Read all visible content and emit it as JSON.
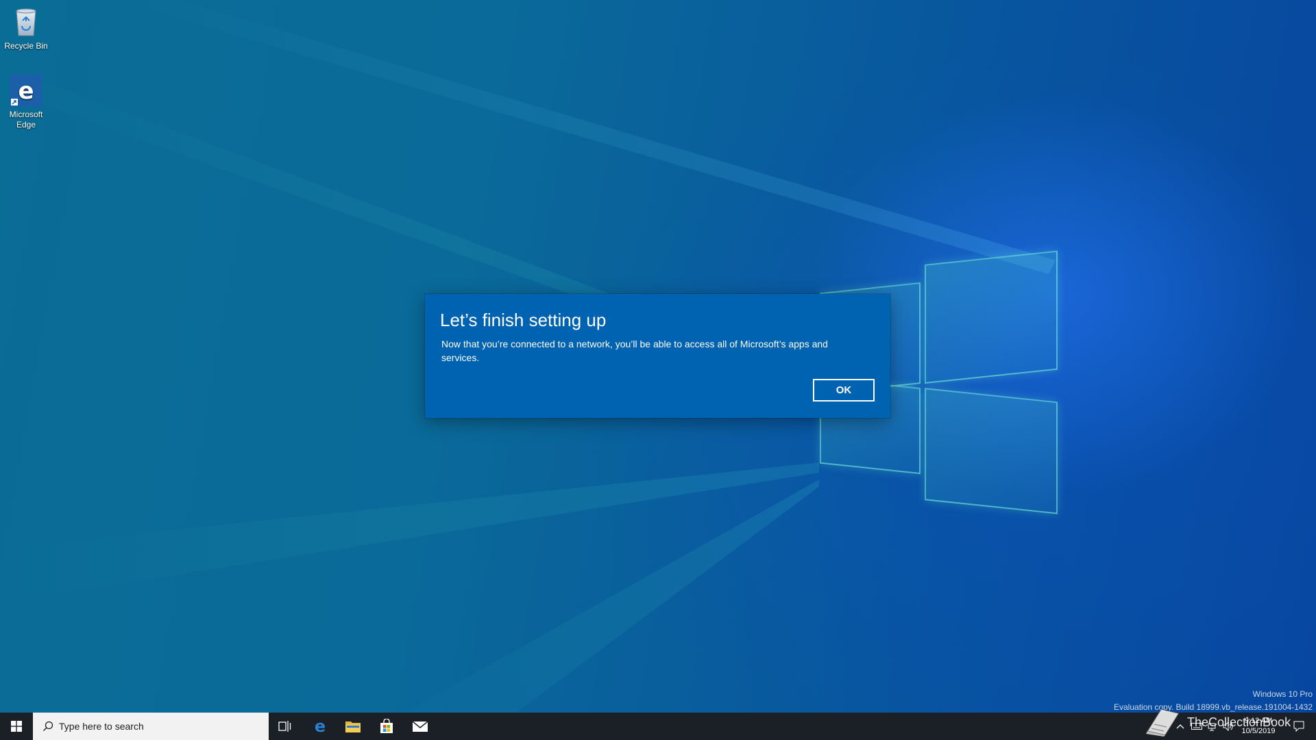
{
  "desktop": {
    "icons": [
      {
        "label": "Recycle Bin",
        "icon": "recycle-bin-icon"
      },
      {
        "label": "Microsoft Edge",
        "icon": "edge-icon"
      }
    ]
  },
  "dialog": {
    "title": "Let’s finish setting up",
    "body": "Now that you’re connected to a network, you’ll be able to access all of Microsoft’s apps and services.",
    "ok_label": "OK",
    "background": "#0063b1"
  },
  "watermark": {
    "line1": "Windows 10 Pro",
    "line2": "Evaluation copy. Build 18999.vb_release.191004-1432"
  },
  "taskbar": {
    "search_placeholder": "Type here to search",
    "pinned": [
      "task-view-icon",
      "edge-icon",
      "file-explorer-icon",
      "store-icon",
      "mail-icon"
    ],
    "clock_time": "9:12 AM",
    "clock_date": "10/5/2019"
  },
  "brand": {
    "text": "TheCollectionBook"
  },
  "colors": {
    "taskbar": "#1b2026",
    "accent": "#0063b1",
    "search_box": "#f2f2f2"
  }
}
